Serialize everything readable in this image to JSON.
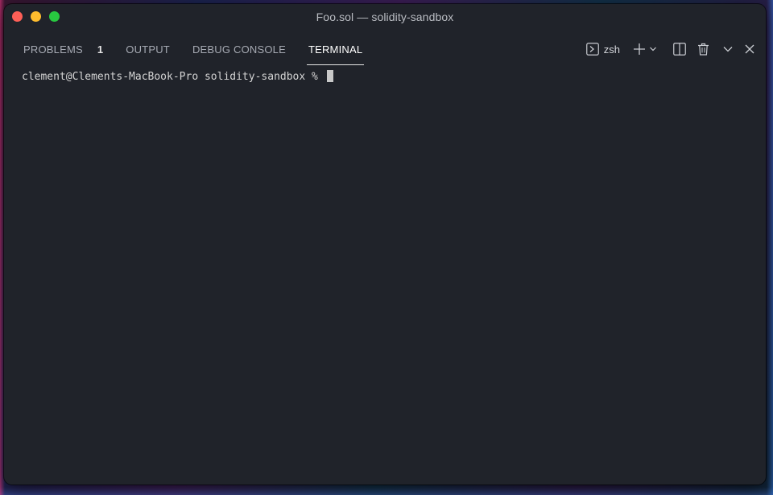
{
  "window": {
    "title": "Foo.sol — solidity-sandbox"
  },
  "panel": {
    "tabs": [
      {
        "label": "PROBLEMS",
        "badge": "1",
        "active": false
      },
      {
        "label": "OUTPUT",
        "active": false
      },
      {
        "label": "DEBUG CONSOLE",
        "active": false
      },
      {
        "label": "TERMINAL",
        "active": true
      }
    ],
    "actions": {
      "shell_label": "zsh",
      "icons": [
        "terminal-icon",
        "plus-icon",
        "chevron-down-icon",
        "split-icon",
        "trash-icon",
        "chevron-down-icon",
        "close-icon"
      ]
    }
  },
  "terminal": {
    "prompt": "clement@Clements-MacBook-Pro solidity-sandbox % "
  },
  "colors": {
    "window_bg": "#20232a",
    "active_tab": "#ffffff",
    "inactive_tab": "#a6aab3",
    "close_light": "#fe5f57",
    "minimize_light": "#febc2e",
    "maximize_light": "#28c840"
  }
}
